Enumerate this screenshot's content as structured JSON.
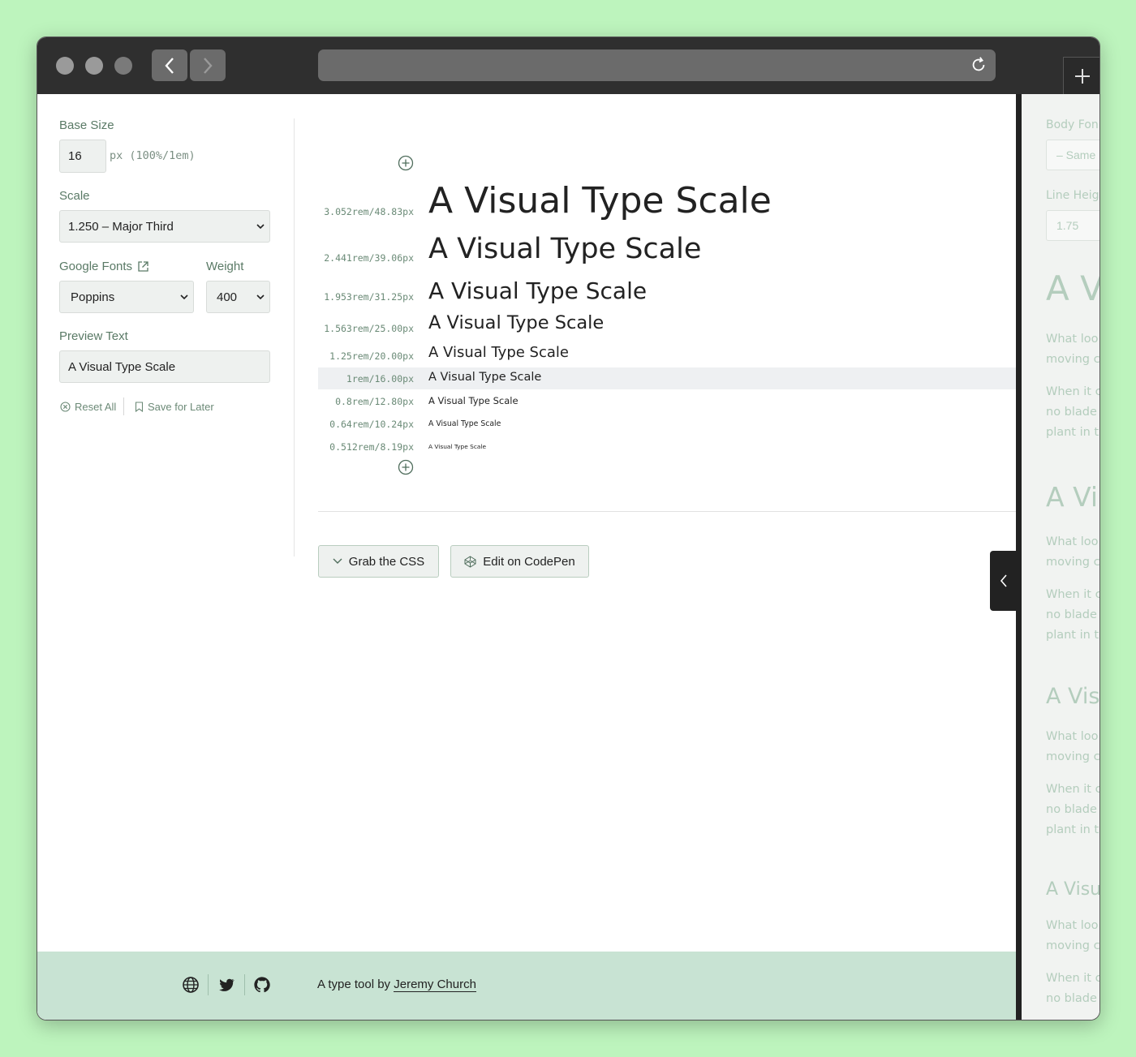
{
  "browser": {
    "back_icon": "chevron-left-icon",
    "forward_icon": "chevron-right-icon",
    "reload_icon": "reload-icon",
    "new_tab_icon": "plus-icon"
  },
  "controls": {
    "base_size_label": "Base Size",
    "base_size_value": "16",
    "base_size_unit": "px (100%/1em)",
    "scale_label": "Scale",
    "scale_value": "1.250 – Major Third",
    "google_fonts_label": "Google Fonts",
    "weight_label": "Weight",
    "font_value": "Poppins",
    "weight_value": "400",
    "preview_text_label": "Preview Text",
    "preview_text_value": "A Visual Type Scale",
    "reset_label": "Reset All",
    "save_label": "Save for Later"
  },
  "scale": {
    "rows": [
      {
        "size": "3.052rem/48.83px",
        "text": "A Visual Type Scale"
      },
      {
        "size": "2.441rem/39.06px",
        "text": "A Visual Type Scale"
      },
      {
        "size": "1.953rem/31.25px",
        "text": "A Visual Type Scale"
      },
      {
        "size": "1.563rem/25.00px",
        "text": "A Visual Type Scale"
      },
      {
        "size": "1.25rem/20.00px",
        "text": "A Visual Type Scale"
      },
      {
        "size": "1rem/16.00px",
        "text": "A Visual Type Scale"
      },
      {
        "size": "0.8rem/12.80px",
        "text": "A Visual Type Scale"
      },
      {
        "size": "0.64rem/10.24px",
        "text": "A Visual Type Scale"
      },
      {
        "size": "0.512rem/8.19px",
        "text": "A Visual Type Scale"
      }
    ]
  },
  "actions": {
    "grab_css_label": "Grab the CSS",
    "codepen_label": "Edit on CodePen"
  },
  "footer": {
    "credit_prefix": "A type tool by",
    "author": "Jeremy Church",
    "icons": [
      "globe-icon",
      "twitter-icon",
      "github-icon"
    ]
  },
  "right_panel": {
    "body_font_label": "Body Fon",
    "body_font_value": "– Same",
    "line_height_label": "Line Heig",
    "line_height_value": "1.75",
    "blocks": [
      {
        "heading": "A V",
        "p1": [
          "What loo",
          "moving c"
        ],
        "p2": [
          "When it c",
          "no blade",
          "plant in t"
        ]
      },
      {
        "heading": "A Vi",
        "p1": [
          "What loo",
          "moving c"
        ],
        "p2": [
          "When it c",
          "no blade",
          "plant in t"
        ]
      },
      {
        "heading": "A Vis",
        "p1": [
          "What loo",
          "moving c"
        ],
        "p2": [
          "When it c",
          "no blade",
          "plant in t"
        ]
      },
      {
        "heading": "A Visu",
        "p1": [
          "What loo",
          "moving c"
        ],
        "p2": [
          "When it c",
          "no blade"
        ]
      }
    ]
  },
  "colors": {
    "page_bg": "#bdf4bd",
    "accent": "#5a7a66",
    "footer_bg": "#c8e3d3"
  }
}
